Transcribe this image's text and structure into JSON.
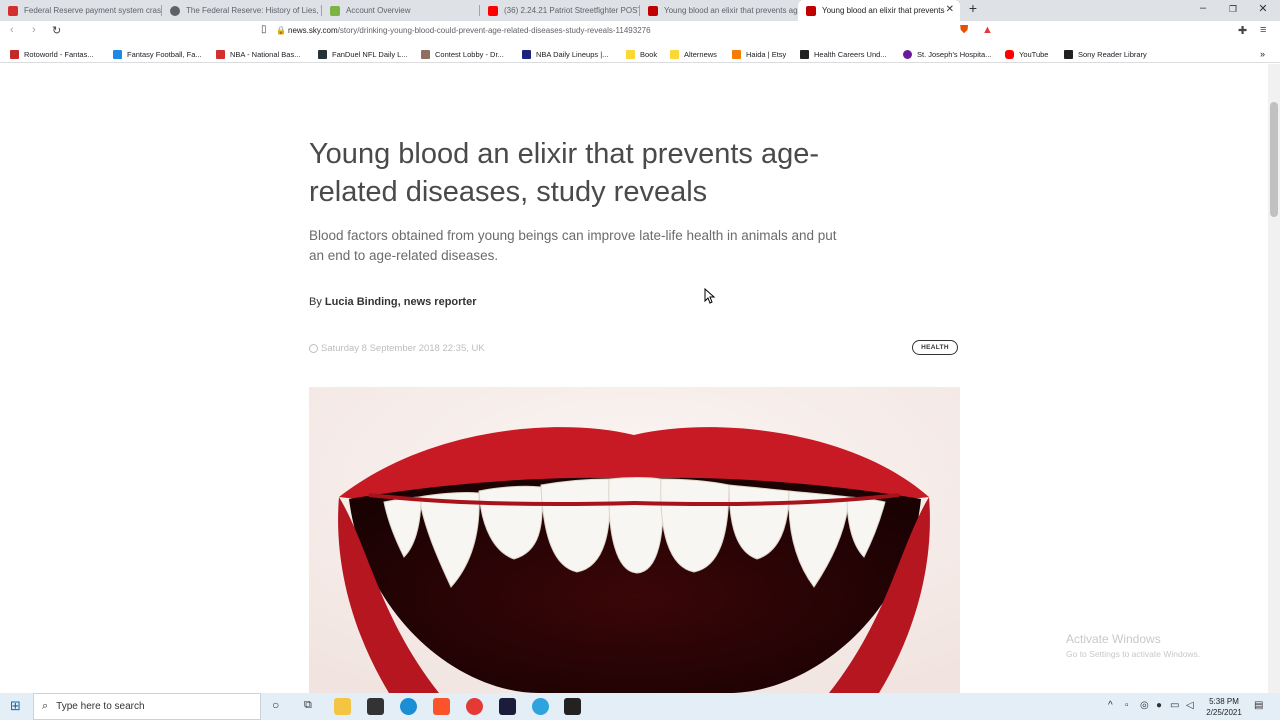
{
  "browser": {
    "tabs": [
      {
        "title": "Federal Reserve payment system crash",
        "color": "#d32f2f"
      },
      {
        "title": "The Federal Reserve: History of Lies, T",
        "color": "#5f6368"
      },
      {
        "title": "Account Overview",
        "color": "#7cb342"
      },
      {
        "title": "(36) 2.24.21 Patriot Streetfighter POST",
        "color": "#ff0000"
      },
      {
        "title": "Young blood an elixir that prevents ag",
        "color": "#c00000"
      },
      {
        "title": "Young blood an elixir that prevents",
        "color": "#c00000"
      }
    ],
    "url_host": "news.sky.com",
    "url_path": "/story/drinking-young-blood-could-prevent-age-related-diseases-study-reveals-11493276",
    "bookmarks": [
      {
        "label": "Rotoworld - Fantas...",
        "color": "#c62828"
      },
      {
        "label": "Fantasy Football, Fa...",
        "color": "#1e88e5"
      },
      {
        "label": "NBA - National Bas...",
        "color": "#d32f2f"
      },
      {
        "label": "FanDuel NFL Daily L...",
        "color": "#263238"
      },
      {
        "label": "Contest Lobby - Dr...",
        "color": "#8d6e63"
      },
      {
        "label": "NBA Daily Lineups |...",
        "color": "#1a237e"
      },
      {
        "label": "Book",
        "color": "#fdd835"
      },
      {
        "label": "Alternews",
        "color": "#fdd835"
      },
      {
        "label": "Haida | Etsy",
        "color": "#f57c00"
      },
      {
        "label": "Health Careers Und...",
        "color": "#212121"
      },
      {
        "label": "St. Joseph's Hospita...",
        "color": "#6a1b9a"
      },
      {
        "label": "YouTube",
        "color": "#ff0000"
      },
      {
        "label": "Sony Reader Library",
        "color": "#212121"
      }
    ]
  },
  "article": {
    "headline": "Young blood an elixir that prevents age-related diseases, study reveals",
    "subhead": "Blood factors obtained from young beings can improve late-life health in animals and put an end to age-related diseases.",
    "byline_prefix": "By",
    "byline_author": "Lucia Binding, news reporter",
    "date": "Saturday 8 September 2018 22:35, UK",
    "tag": "HEALTH"
  },
  "watermark": {
    "line1": "Activate Windows",
    "line2": "Go to Settings to activate Windows."
  },
  "taskbar": {
    "search_placeholder": "Type here to search",
    "time": "5:38 PM",
    "date": "2/25/2021"
  }
}
